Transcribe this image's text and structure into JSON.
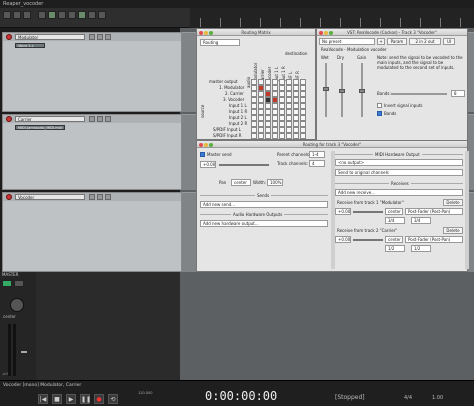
{
  "app": {
    "title": "Reaper_vocoder"
  },
  "tracks": [
    {
      "name": "Modulator",
      "item": "Voice 1.L"
    },
    {
      "name": "Carrier",
      "item": "MIDI-Jamstudio_MIDI.mid"
    },
    {
      "name": "Vocoder",
      "item": "Voice 1.L"
    }
  ],
  "mixer": {
    "master_label": "MASTER",
    "pan_label": "center",
    "meter_value": "-inf"
  },
  "transport": {
    "label": "Vocoder [mono] Modulator, Carrier",
    "time": "0:00:00:00",
    "status": "[Stopped]",
    "bpm_label": "120.000",
    "time_sig": "4/4",
    "rate": "1.00"
  },
  "routing_matrix": {
    "title": "Routing Matrix",
    "mode": "Routing",
    "source_label": "source",
    "destination_label": "destination",
    "sources": [
      "master output",
      "1. Modulator",
      "2. Carrier",
      "3. Vocoder",
      "Input 1 L",
      "Input 1 R",
      "Input 2 L",
      "Input 2 R",
      "S/PDIF Input L",
      "S/PDIF Input R"
    ],
    "destinations": [
      "audio",
      "1. Modulator",
      "2. Carrier",
      "3. Vocoder",
      "Output 1 L",
      "Output 1 R",
      "S/PDIF L",
      "S/PDIF R"
    ]
  },
  "vst_window": {
    "title": "VST: ReaVocode (Cockos) - Track 3 \"Vocoder\"",
    "preset": "No preset",
    "preset_btn": "+",
    "param_btn": "Param",
    "io_btn": "2 in 2 out",
    "ui_btn": "UI",
    "plugin_name": "ReaVocode - Modulation vocoder",
    "col_wet": "Wet",
    "col_dry": "Dry",
    "col_gain": "Gain",
    "note": "Note: send the signal to be vocoded to the main inputs, and the signal to be modulated to the second set of inputs.",
    "bands_label": "Bands:",
    "bands_value": "8",
    "invert_label": "Invert signal inputs",
    "bands_btn": "Bands"
  },
  "routing_track": {
    "title": "Routing for track 3 \"Vocoder\"",
    "master_send": "Master send",
    "parent_channels_label": "Parent channels:",
    "parent_channels_value": "1-4",
    "track_channels_label": "Track channels:",
    "track_channels_value": "4",
    "vol_value": "+0.00",
    "pan_value": "center",
    "width_label": "Width:",
    "width_value": "100%",
    "pan_label": "Pan",
    "sends_label": "Sends",
    "add_send": "Add new send...",
    "hw_outputs_label": "Audio Hardware Outputs",
    "add_hw_output": "Add new hardware output...",
    "midi_hw_output_label": "MIDI Hardware Output",
    "midi_output": "<no output>",
    "midi_send": "Send to original channels",
    "receives_label": "Receives",
    "add_receive": "Add new receive...",
    "receive1_title": "Receive from track 1 \"Modulator\"",
    "receive2_title": "Receive from track 2 \"Carrier\"",
    "delete_btn": "Delete",
    "post_fader": "Post-Fader (Post-Pan)",
    "rcv_vol": "+0.00",
    "rcv_pan": "center",
    "rcv_ch1": "1/2",
    "rcv_ch2": "3/4"
  }
}
